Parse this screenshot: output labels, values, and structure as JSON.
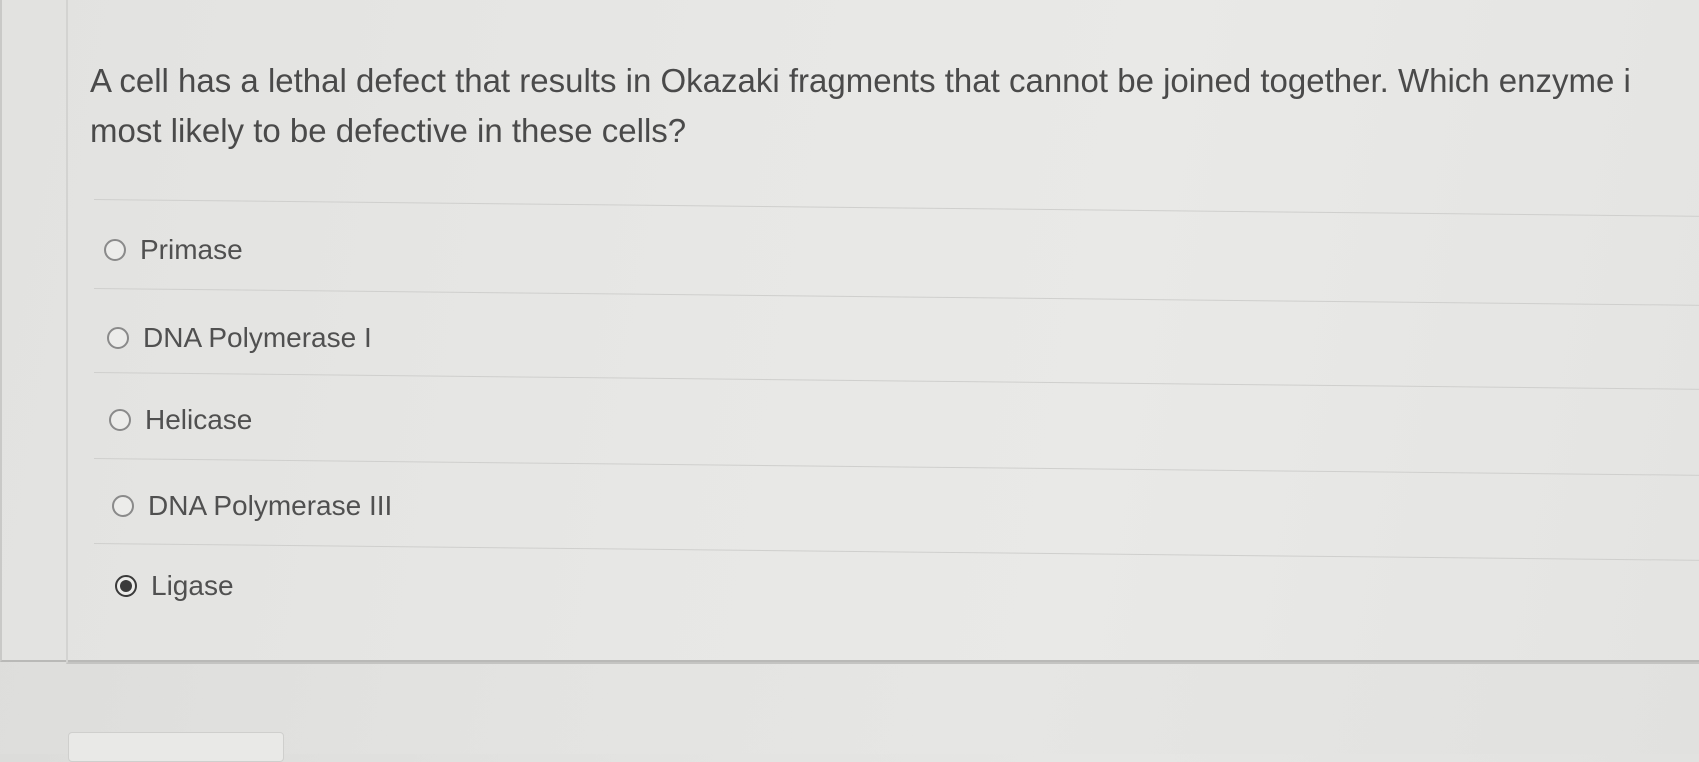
{
  "question": {
    "line1": "A cell has a lethal defect that results in Okazaki fragments that cannot be joined together. Which enzyme i",
    "line2": "most likely to be defective in these cells?"
  },
  "options": [
    {
      "label": "Primase",
      "selected": false
    },
    {
      "label": "DNA Polymerase I",
      "selected": false
    },
    {
      "label": "Helicase",
      "selected": false
    },
    {
      "label": "DNA Polymerase III",
      "selected": false
    },
    {
      "label": "Ligase",
      "selected": true
    }
  ]
}
